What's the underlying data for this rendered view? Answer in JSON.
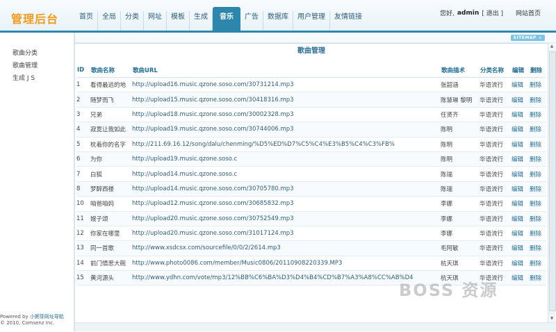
{
  "app": {
    "title": "管理后台"
  },
  "nav": {
    "items": [
      {
        "label": "首页",
        "active": false
      },
      {
        "label": "全局",
        "active": false
      },
      {
        "label": "分类",
        "active": false
      },
      {
        "label": "网址",
        "active": false
      },
      {
        "label": "模板",
        "active": false
      },
      {
        "label": "生成",
        "active": false
      },
      {
        "label": "音乐",
        "active": true
      },
      {
        "label": "广告",
        "active": false
      },
      {
        "label": "数据库",
        "active": false
      },
      {
        "label": "用户管理",
        "active": false
      },
      {
        "label": "友情链接",
        "active": false
      }
    ]
  },
  "user": {
    "greeting": "您好,",
    "name": "admin",
    "logout": "[ 退出 ]",
    "site_home": "网站首页"
  },
  "subbar": {
    "sitemap": "SITEMAP ⇣"
  },
  "sidebar": {
    "items": [
      {
        "label": "歌曲分类"
      },
      {
        "label": "歌曲管理"
      },
      {
        "label": "生成 J S"
      }
    ]
  },
  "footer": {
    "powered": "Powered by ",
    "brand": "小粥芽网址导航",
    "copyright": "© 2010, Comsenz Inc."
  },
  "panel": {
    "title": "歌曲管理"
  },
  "table": {
    "headers": {
      "id": "ID",
      "name": "歌曲名称",
      "url": "歌曲URL",
      "artist": "歌曲描术",
      "category": "分类名称",
      "edit": "编辑",
      "delete": "删除"
    },
    "rows": [
      {
        "id": "1",
        "name": "看得最远的地",
        "url": "http://upload16.music.qzone.soso.com/30731214.mp3",
        "artist": "张韶涵",
        "category": "华语流行",
        "edit": "编辑",
        "delete": "删除"
      },
      {
        "id": "2",
        "name": "随梦而飞",
        "url": "http://upload15.music.qzone.soso.com/30418316.mp3",
        "artist": "陈慧琳 黎明",
        "category": "华语流行",
        "edit": "编辑",
        "delete": "删除"
      },
      {
        "id": "3",
        "name": "兄弟",
        "url": "http://upload18.music.qzone.soso.com/30002328.mp3",
        "artist": "任贤齐",
        "category": "华语流行",
        "edit": "编辑",
        "delete": "删除"
      },
      {
        "id": "4",
        "name": "寂寞让我如此",
        "url": "http://upload19.music.qzone.soso.com/30744006.mp3",
        "artist": "陈明",
        "category": "华语流行",
        "edit": "编辑",
        "delete": "删除"
      },
      {
        "id": "5",
        "name": "枕着你的名字",
        "url": "http://211.69.16.12/song/dalu/chenming/%D5%ED%D7%C5%C4%E3%B5%C4%C3%FB%",
        "artist": "陈明",
        "category": "华语流行",
        "edit": "编辑",
        "delete": "删除"
      },
      {
        "id": "6",
        "name": "为你",
        "url": "http://upload19.music.qzone.soso.c",
        "artist": "陈明",
        "category": "华语流行",
        "edit": "编辑",
        "delete": "删除"
      },
      {
        "id": "7",
        "name": "白狐",
        "url": "http://upload14.music.qzone.soso.c",
        "artist": "陈瑞",
        "category": "华语流行",
        "edit": "编辑",
        "delete": "删除"
      },
      {
        "id": "8",
        "name": "梦醉西楼",
        "url": "http://upload14.music.qzone.soso.com/30705780.mp3",
        "artist": "陈瑞",
        "category": "华语流行",
        "edit": "编辑",
        "delete": "删除"
      },
      {
        "id": "10",
        "name": "咱爸咱妈",
        "url": "http://upload12.music.qzone.soso.com/30685832.mp3",
        "artist": "李娜",
        "category": "华语流行",
        "edit": "编辑",
        "delete": "删除"
      },
      {
        "id": "11",
        "name": "嫂子颂",
        "url": "http://upload20.music.qzone.soso.com/30752549.mp3",
        "artist": "李娜",
        "category": "华语流行",
        "edit": "编辑",
        "delete": "删除"
      },
      {
        "id": "12",
        "name": "你家在哪里",
        "url": "http://upload20.music.qzone.soso.com/31017124.mp3",
        "artist": "李娜",
        "category": "华语流行",
        "edit": "编辑",
        "delete": "删除"
      },
      {
        "id": "13",
        "name": "同一首歌",
        "url": "http://www.xsdcsx.com/sourcefile/0/0/2/2614.mp3",
        "artist": "毛阿敏",
        "category": "华语流行",
        "edit": "编辑",
        "delete": "删除"
      },
      {
        "id": "14",
        "name": "前门情思大碗",
        "url": "http://www.photo0086.com/member/Music0806/20110908220339.MP3",
        "artist": "杭天琪",
        "category": "华语流行",
        "edit": "编辑",
        "delete": "删除"
      },
      {
        "id": "15",
        "name": "黄河源头",
        "url": "http://www.ydhn.com/vote/mp3/12%BB%C6%BA%D3%D4%B4%CD%B7%A3%A8%CC%AB%D4",
        "artist": "杭天琪",
        "category": "华语流行",
        "edit": "编辑",
        "delete": "删除"
      }
    ]
  },
  "scroll": {
    "up": "▲",
    "down": "▼"
  },
  "watermark": {
    "text": "BOSS 资源"
  }
}
